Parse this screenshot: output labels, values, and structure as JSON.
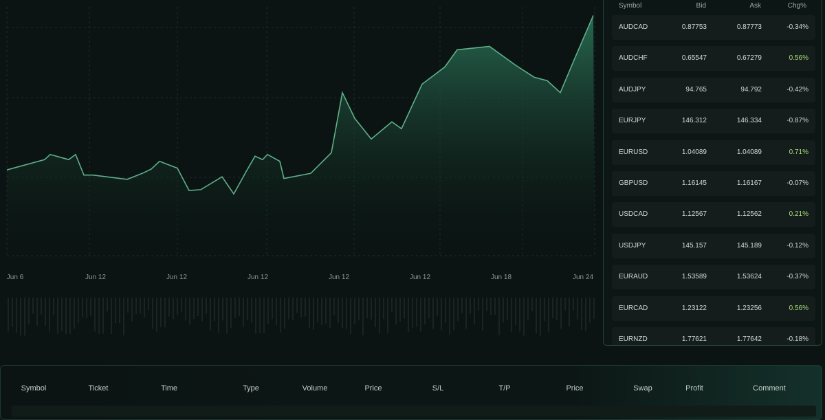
{
  "chart": {
    "x_ticks": [
      "Jun 6",
      "Jun 12",
      "Jun 12",
      "Jun 12",
      "Jun 12",
      "Jun 12",
      "Jun 18",
      "Jun 24"
    ],
    "line_color": "#5fb08a",
    "fill_color": "#1f5b46"
  },
  "chart_data": {
    "type": "area",
    "xlabel": "",
    "ylabel": "",
    "grid": true,
    "values": [
      10,
      11.2,
      11.8,
      11.2,
      11.8,
      9.4,
      9.4,
      8.9,
      9.6,
      10.1,
      11,
      10.2,
      7.6,
      7.7,
      9.2,
      7.2,
      9.8,
      11.6,
      11.2,
      11.8,
      11,
      9,
      9.6,
      12,
      19,
      16,
      13.6,
      15.6,
      14.8,
      20,
      22,
      24,
      24.4,
      22.2,
      20.8,
      20.4,
      19,
      23,
      28
    ]
  },
  "watchlist": {
    "headers": {
      "symbol": "Symbol",
      "bid": "Bid",
      "ask": "Ask",
      "chg": "Chg%"
    },
    "rows": [
      {
        "symbol": "AUDCAD",
        "bid": "0.87753",
        "ask": "0.87773",
        "chg": "-0.34%",
        "dir": "neg"
      },
      {
        "symbol": "AUDCHF",
        "bid": "0.65547",
        "ask": "0.67279",
        "chg": "0.56%",
        "dir": "pos"
      },
      {
        "symbol": "AUDJPY",
        "bid": "94.765",
        "ask": "94.792",
        "chg": "-0.42%",
        "dir": "neg"
      },
      {
        "symbol": "EURJPY",
        "bid": "146.312",
        "ask": "146.334",
        "chg": "-0.87%",
        "dir": "neg"
      },
      {
        "symbol": "EURUSD",
        "bid": "1.04089",
        "ask": "1.04089",
        "chg": "0.71%",
        "dir": "pos"
      },
      {
        "symbol": "GBPUSD",
        "bid": "1.16145",
        "ask": "1.16167",
        "chg": "-0.07%",
        "dir": "neg"
      },
      {
        "symbol": "USDCAD",
        "bid": "1.12567",
        "ask": "1.12562",
        "chg": "0.21%",
        "dir": "pos"
      },
      {
        "symbol": "USDJPY",
        "bid": "145.157",
        "ask": "145.189",
        "chg": "-0.12%",
        "dir": "neg"
      },
      {
        "symbol": "EURAUD",
        "bid": "1.53589",
        "ask": "1.53624",
        "chg": "-0.37%",
        "dir": "neg"
      },
      {
        "symbol": "EURCAD",
        "bid": "1.23122",
        "ask": "1.23256",
        "chg": "0.56%",
        "dir": "pos"
      },
      {
        "symbol": "EURNZD",
        "bid": "1.77621",
        "ask": "1.77642",
        "chg": "-0.18%",
        "dir": "neg"
      }
    ]
  },
  "orders": {
    "columns": [
      "Symbol",
      "Ticket",
      "Time",
      "Type",
      "Volume",
      "Price",
      "S/L",
      "T/P",
      "Price",
      "Swap",
      "Profit",
      "Comment"
    ]
  }
}
